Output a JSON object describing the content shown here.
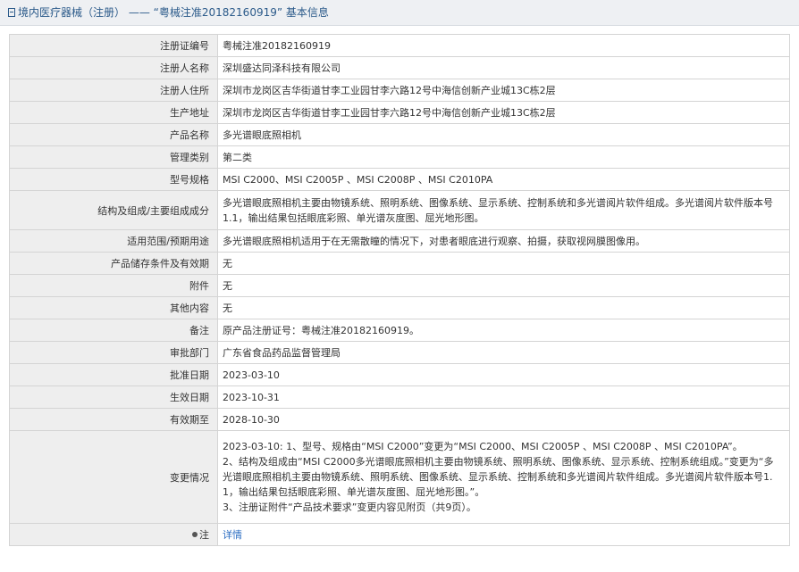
{
  "header": {
    "prefix": "境内医疗器械（注册）",
    "separator": " —— ",
    "title": "“粤械注准20182160919” 基本信息"
  },
  "rows": [
    {
      "label": "注册证编号",
      "value": "粤械注准20182160919"
    },
    {
      "label": "注册人名称",
      "value": "深圳盛达同泽科技有限公司"
    },
    {
      "label": "注册人住所",
      "value": "深圳市龙岗区吉华街道甘李工业园甘李六路12号中海信创新产业城13C栋2层"
    },
    {
      "label": "生产地址",
      "value": "深圳市龙岗区吉华街道甘李工业园甘李六路12号中海信创新产业城13C栋2层"
    },
    {
      "label": "产品名称",
      "value": "多光谱眼底照相机"
    },
    {
      "label": "管理类别",
      "value": "第二类"
    },
    {
      "label": "型号规格",
      "value": "MSI C2000、MSI C2005P 、MSI C2008P 、MSI C2010PA"
    },
    {
      "label": "结构及组成/主要组成成分",
      "value": "多光谱眼底照相机主要由物镜系统、照明系统、图像系统、显示系统、控制系统和多光谱阅片软件组成。多光谱阅片软件版本号1.1，输出结果包括眼底彩照、单光谱灰度图、屈光地形图。"
    },
    {
      "label": "适用范围/预期用途",
      "value": "多光谱眼底照相机适用于在无需散瞳的情况下，对患者眼底进行观察、拍摄，获取视网膜图像用。"
    },
    {
      "label": "产品储存条件及有效期",
      "value": "无"
    },
    {
      "label": "附件",
      "value": "无"
    },
    {
      "label": "其他内容",
      "value": "无"
    },
    {
      "label": "备注",
      "value": "原产品注册证号：粤械注准20182160919。"
    },
    {
      "label": "审批部门",
      "value": "广东省食品药品监督管理局"
    },
    {
      "label": "批准日期",
      "value": "2023-03-10"
    },
    {
      "label": "生效日期",
      "value": "2023-10-31"
    },
    {
      "label": "有效期至",
      "value": "2028-10-30"
    }
  ],
  "changes": {
    "label": "变更情况",
    "lines": [
      "2023-03-10: 1、型号、规格由“MSI C2000”变更为“MSI C2000、MSI C2005P 、MSI C2008P 、MSI C2010PA”。",
      "2、结构及组成由“MSI C2000多光谱眼底照相机主要由物镜系统、照明系统、图像系统、显示系统、控制系统组成。”变更为“多光谱眼底照相机主要由物镜系统、照明系统、图像系统、显示系统、控制系统和多光谱阅片软件组成。多光谱阅片软件版本号1.1，输出结果包括眼底彩照、单光谱灰度图、屈光地形图。”。",
      "3、注册证附件“产品技术要求”变更内容见附页（共9页）。"
    ]
  },
  "note": {
    "label": "注",
    "link": "详情"
  }
}
